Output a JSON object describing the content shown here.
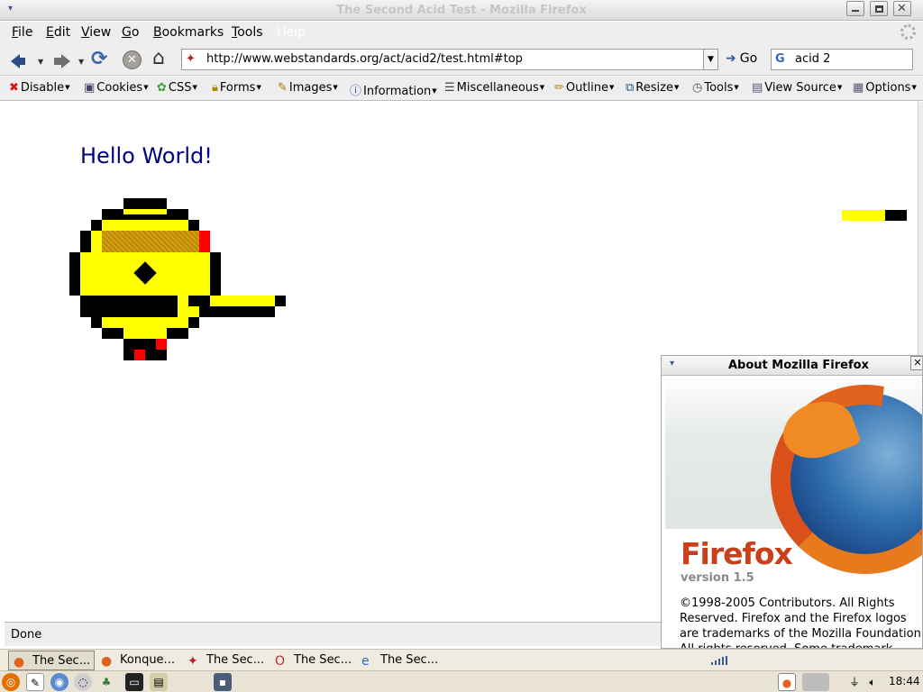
{
  "window": {
    "title": "The Second Acid Test - Mozilla Firefox",
    "menu_glyph": "▾",
    "close_glyph": "✕"
  },
  "menubar": {
    "items": [
      "File",
      "Edit",
      "View",
      "Go",
      "Bookmarks",
      "Tools",
      "Help"
    ]
  },
  "navbar": {
    "url": "http://www.webstandards.org/act/acid2/test.html#top",
    "go_label": "Go",
    "search_value": "acid 2",
    "search_engine_glyph": "G"
  },
  "devtoolbar": {
    "items": [
      "Disable",
      "Cookies",
      "CSS",
      "Forms",
      "Images",
      "Information",
      "Miscellaneous",
      "Outline",
      "Resize",
      "Tools",
      "View Source",
      "Options"
    ]
  },
  "content": {
    "heading": "Hello World!",
    "colors": {
      "heading": "#000080",
      "face_fill": "#ffff00",
      "face_outline": "#000000",
      "accent_red": "#ff0000",
      "hair": "#b8860b"
    }
  },
  "statusbar": {
    "text": "Done"
  },
  "about_dialog": {
    "title": "About Mozilla Firefox",
    "brand": "Firefox",
    "version": "version 1.5",
    "copyright": "©1998-2005 Contributors. All Rights Reserved. Firefox and the Firefox logos are trademarks of the Mozilla Foundation. All rights reserved. Some trademark rights"
  },
  "taskbar": {
    "tasks": [
      "The Sec...",
      "Konque...",
      "The Sec...",
      "The Sec...",
      "The Sec..."
    ]
  },
  "panel": {
    "clock": "18:44"
  }
}
